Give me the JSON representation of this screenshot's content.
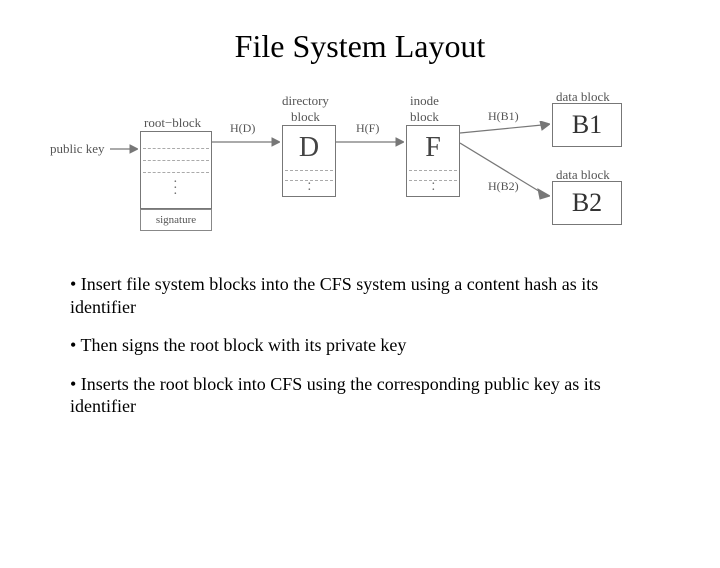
{
  "title": "File System Layout",
  "diagram": {
    "labels": {
      "public_key": "public key",
      "root_block": "root−block",
      "hd": "H(D)",
      "directory_block": "directory\nblock",
      "d": "D",
      "hf": "H(F)",
      "inode_block": "inode\nblock",
      "f": "F",
      "hb1": "H(B1)",
      "data_block1": "data block",
      "b1": "B1",
      "hb2": "H(B2)",
      "data_block2": "data block",
      "b2": "B2",
      "signature": "signature"
    }
  },
  "bullets": {
    "b1": "• Insert file system blocks into the CFS system using a content hash as its identifier",
    "b2": "• Then signs the root block with its private key",
    "b3": "• Inserts  the root block into CFS using the corresponding public key as its identifier"
  }
}
